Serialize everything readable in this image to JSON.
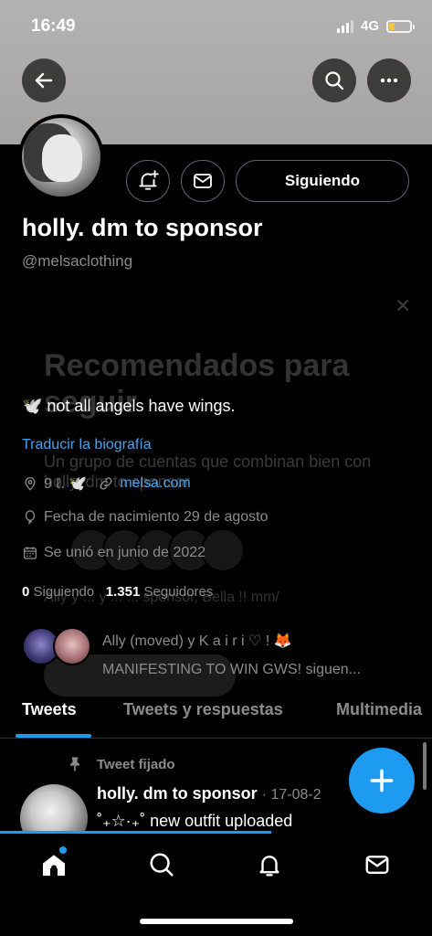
{
  "status_bar": {
    "time": "16:49",
    "network": "4G",
    "battery_level": 0.25,
    "battery_color": "#f6c445"
  },
  "header": {
    "back_icon": "arrow-left-icon",
    "search_icon": "search-icon",
    "more_icon": "more-icon"
  },
  "profile": {
    "display_name": "holly. dm to sponsor",
    "handle": "@melsaclothing",
    "follow_button": "Siguiendo",
    "notify_icon": "bell-plus-icon",
    "message_icon": "envelope-icon",
    "bio": "🕊️ not all angels have wings.",
    "translate_link": "Traducir la biografía",
    "location": "9 ℓ. 🕊️",
    "website": "melsa.com",
    "birthday": "Fecha de nacimiento 29 de agosto",
    "joined": "Se unió en junio de 2022",
    "following_count": "0",
    "following_label": "Siguiendo",
    "followers_count": "1.351",
    "followers_label": "Seguidores",
    "followed_by_line1": "Ally (moved) y K a i r i ♡ ! 🦊",
    "followed_by_line2": "MANIFESTING TO WIN GWS! siguen..."
  },
  "overlay": {
    "title": "Recomendados para seguir",
    "description": "Un grupo de cuentas que combinan bien con holly. dm to sponsor",
    "line": "Ally y ... y ... ... sponsor, Bella !! mm/",
    "close": "✕"
  },
  "tabs": [
    {
      "label": "Tweets",
      "active": true
    },
    {
      "label": "Tweets y respuestas",
      "active": false
    },
    {
      "label": "Multimedia",
      "active": false
    }
  ],
  "tweet": {
    "pinned_label": "Tweet fijado",
    "author": "holly. dm to sponsor",
    "date": "· 17-08-2",
    "text": "˚₊☆·₊˚ new outfit uploaded"
  },
  "bottom_nav": {
    "items": [
      "home-icon",
      "search-icon",
      "notifications-icon",
      "messages-icon"
    ]
  },
  "colors": {
    "accent": "#1d9bf0",
    "link": "#4aa3e8",
    "muted": "#8b8b8b",
    "background": "#000000"
  }
}
